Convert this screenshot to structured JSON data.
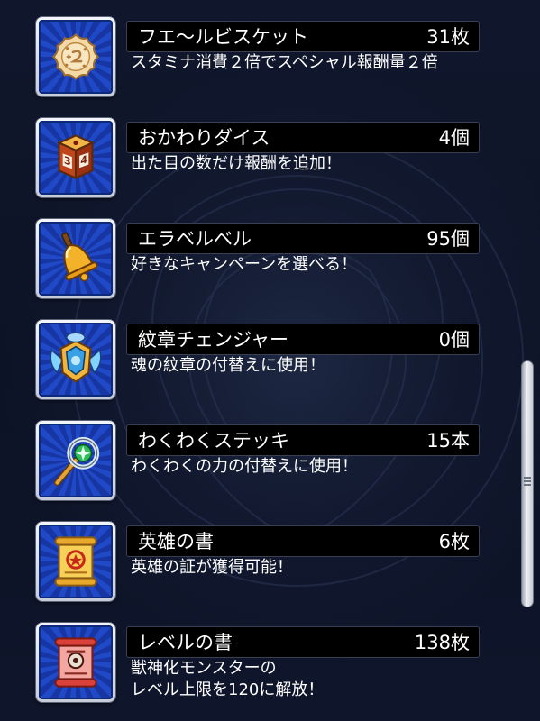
{
  "items": [
    {
      "icon": "biscuit-icon",
      "name": "フエ〜ルビスケット",
      "count": "31枚",
      "description": "スタミナ消費２倍でスペシャル報酬量２倍"
    },
    {
      "icon": "dice-icon",
      "name": "おかわりダイス",
      "count": "4個",
      "description": "出た目の数だけ報酬を追加！"
    },
    {
      "icon": "bell-icon",
      "name": "エラベルベル",
      "count": "95個",
      "description": "好きなキャンペーンを選べる！"
    },
    {
      "icon": "emblem-changer-icon",
      "name": "紋章チェンジャー",
      "count": "0個",
      "description": "魂の紋章の付替えに使用！"
    },
    {
      "icon": "wand-icon",
      "name": "わくわくステッキ",
      "count": "15本",
      "description": "わくわくの力の付替えに使用！"
    },
    {
      "icon": "scroll-yellow-icon",
      "name": "英雄の書",
      "count": "6枚",
      "description": "英雄の証が獲得可能！"
    },
    {
      "icon": "scroll-red-icon",
      "name": "レベルの書",
      "count": "138枚",
      "description": "獣神化モンスターの\nレベル上限を120に解放！"
    }
  ],
  "colors": {
    "frame_blue": "#2049c8",
    "name_bar": "#000000",
    "text": "#ffffff",
    "background": "#0c1122"
  }
}
